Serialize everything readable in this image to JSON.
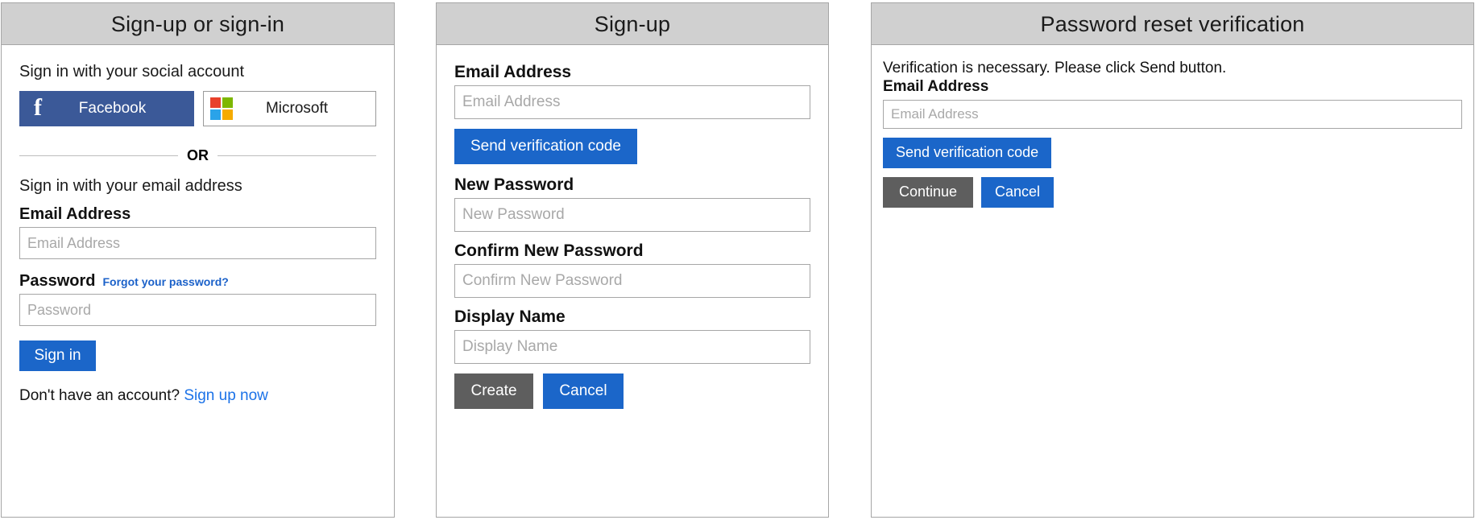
{
  "panels": {
    "signin": {
      "title": "Sign-up or sign-in",
      "social_heading": "Sign in with your social account",
      "facebook_label": "Facebook",
      "facebook_color": "#3b5998",
      "facebook_icon": "facebook-f-icon",
      "microsoft_label": "Microsoft",
      "microsoft_icon": "microsoft-logo-icon",
      "microsoft_colors": [
        "#e8412b",
        "#7db700",
        "#2aa3e9",
        "#f5ab00"
      ],
      "divider_text": "OR",
      "email_heading": "Sign in with your email address",
      "email_label": "Email Address",
      "email_placeholder": "Email Address",
      "email_value": "",
      "password_label": "Password",
      "forgot_link": "Forgot your password?",
      "password_placeholder": "Password",
      "password_value": "",
      "signin_button": "Sign in",
      "signup_prompt": "Don't have an account?",
      "signup_link": "Sign up now",
      "link_color": "#1b72e8",
      "primary_color": "#1b66c9"
    },
    "signup": {
      "title": "Sign-up",
      "email_label": "Email Address",
      "email_placeholder": "Email Address",
      "email_value": "",
      "send_code_button": "Send verification code",
      "new_password_label": "New Password",
      "new_password_placeholder": "New Password",
      "new_password_value": "",
      "confirm_password_label": "Confirm New Password",
      "confirm_password_placeholder": "Confirm New Password",
      "confirm_password_value": "",
      "display_name_label": "Display Name",
      "display_name_placeholder": "Display Name",
      "display_name_value": "",
      "create_button": "Create",
      "cancel_button": "Cancel",
      "primary_color": "#1b66c9",
      "secondary_color": "#5e5e5e"
    },
    "reset": {
      "title": "Password reset verification",
      "note": "Verification is necessary. Please click Send button.",
      "email_label": "Email Address",
      "email_placeholder": "Email Address",
      "email_value": "",
      "send_code_button": "Send verification code",
      "continue_button": "Continue",
      "cancel_button": "Cancel",
      "primary_color": "#1b66c9",
      "secondary_color": "#5e5e5e"
    }
  }
}
